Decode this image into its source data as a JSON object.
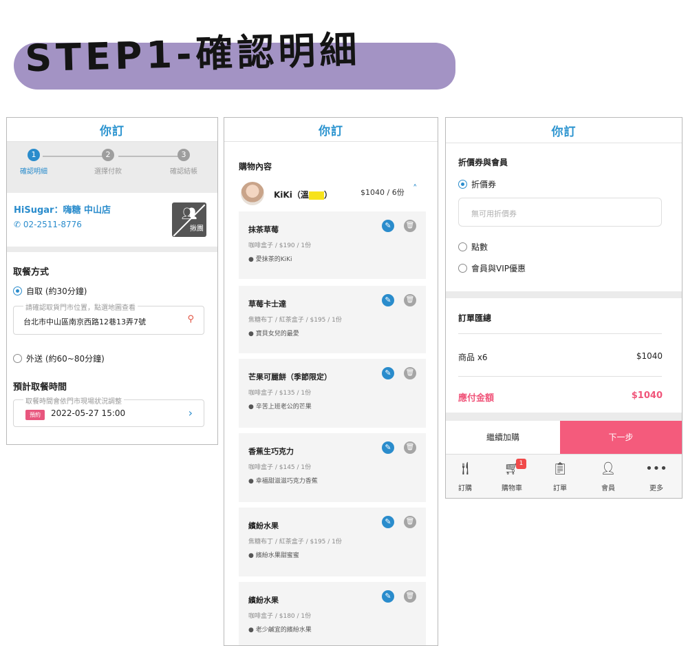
{
  "title": "STEP1-確認明細",
  "brand": "你訂",
  "colors": {
    "accent": "#2a8ccc",
    "pink": "#f45b7c",
    "banner": "#a393c4"
  },
  "step_page": {
    "steps": [
      {
        "num": "1",
        "label": "確認明細",
        "active": true
      },
      {
        "num": "2",
        "label": "選擇付款",
        "active": false
      },
      {
        "num": "3",
        "label": "確認結帳",
        "active": false
      }
    ],
    "store_name": "HiSugar：嗨糖 中山店",
    "store_phone": "02-2511-8776",
    "group_label": "揪團",
    "pickup_title": "取餐方式",
    "option_self": "自取 (約30分鐘)",
    "address_legend": "請確認取貨門市位置，點選地圖查看",
    "address": "台北市中山區南京西路12巷13弄7號",
    "option_delivery": "外送 (約60~80分鐘)",
    "time_title": "預計取餐時間",
    "time_legend": "取餐時間會依門市現場狀況調整",
    "time_badge": "預約",
    "time_value": "2022-05-27 15:00"
  },
  "cart_page": {
    "heading": "購物內容",
    "user_name": "KiKi（溫",
    "user_close": "）",
    "summary": "$1040 / 6份",
    "items": [
      {
        "name": "抹茶草莓",
        "desc": "咖啡盒子 / $190 / 1份",
        "note": "愛抹茶的KiKi"
      },
      {
        "name": "草莓卡士達",
        "desc": "焦糖布丁 / 紅茶盒子 / $195 / 1份",
        "note": "寶貝女兒的最愛"
      },
      {
        "name": "芒果可麗餅（季節限定）",
        "desc": "咖啡盒子 / $135 / 1份",
        "note": "辛苦上班老公的芒果"
      },
      {
        "name": "香蕉生巧克力",
        "desc": "咖啡盒子 / $145 / 1份",
        "note": "幸福甜滋滋巧克力香蕉"
      },
      {
        "name": "繽紛水果",
        "desc": "焦糖布丁 / 紅茶盒子 / $195 / 1份",
        "note": "繽紛水果甜蜜蜜"
      },
      {
        "name": "繽紛水果",
        "desc": "咖啡盒子 / $180 / 1份",
        "note": "老少鹹宜的繽紛水果"
      }
    ]
  },
  "checkout_page": {
    "coupon_title": "折價券與會員",
    "opt_coupon": "折價券",
    "coupon_placeholder": "無可用折價券",
    "opt_points": "點數",
    "opt_vip": "會員與VIP優惠",
    "summary_title": "訂單匯總",
    "items_label": "商品 x6",
    "items_value": "$1040",
    "total_label": "應付金額",
    "total_value": "$1040",
    "btn_continue": "繼續加購",
    "btn_next": "下一步",
    "tabs": [
      {
        "label": "訂購",
        "icon": "utensils-icon"
      },
      {
        "label": "購物車",
        "icon": "cart-icon",
        "badge": "1"
      },
      {
        "label": "訂單",
        "icon": "clipboard-icon"
      },
      {
        "label": "會員",
        "icon": "user-icon"
      },
      {
        "label": "更多",
        "icon": "more-icon"
      }
    ]
  }
}
